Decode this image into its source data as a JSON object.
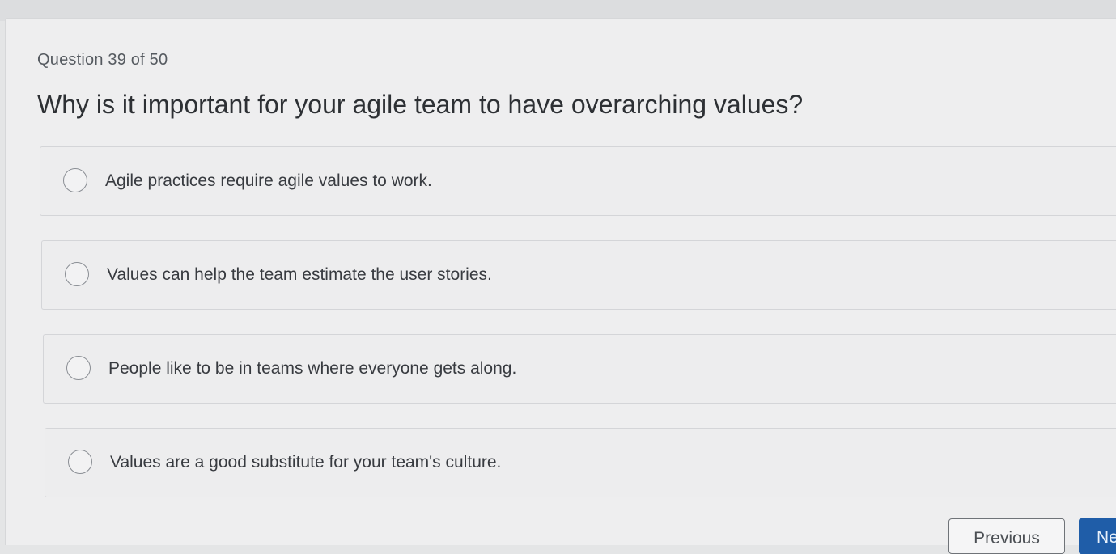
{
  "quiz": {
    "counter": "Question 39 of 50",
    "question": "Why is it important for your agile team to have overarching values?",
    "options": [
      {
        "label": "Agile practices require agile values to work.",
        "selected": false
      },
      {
        "label": "Values can help the team estimate the user stories.",
        "selected": false
      },
      {
        "label": "People like to be in teams where everyone gets along.",
        "selected": false
      },
      {
        "label": "Values are a good substitute for your team's culture.",
        "selected": false
      }
    ]
  },
  "nav": {
    "previous_label": "Previous",
    "next_label": "Ne"
  },
  "colors": {
    "accent": "#1f5da8",
    "background": "#eeeeef"
  }
}
